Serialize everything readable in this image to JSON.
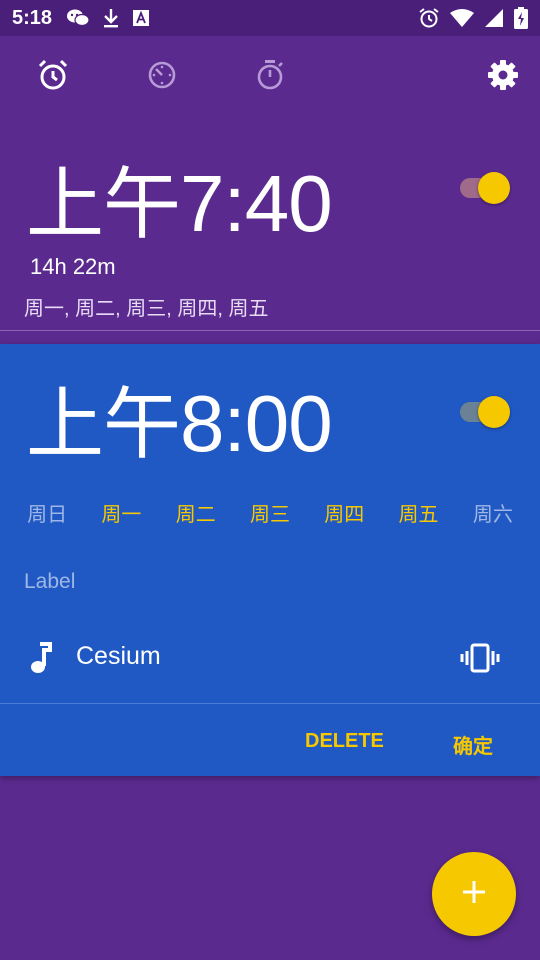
{
  "status_bar": {
    "time": "5:18",
    "left_icons": [
      "wechat-icon",
      "download-icon",
      "text-a-icon"
    ],
    "right_icons": [
      "alarm-clock-icon",
      "wifi-icon",
      "signal-icon",
      "battery-charging-icon"
    ]
  },
  "toolbar": {
    "tabs": [
      "alarm-icon",
      "clock-icon",
      "stopwatch-icon"
    ],
    "settings_icon": "gear-icon"
  },
  "alarms": [
    {
      "ampm": "上午",
      "time": "7:40",
      "remaining": "14h 22m",
      "days_summary": "周一, 周二, 周三, 周四, 周五",
      "enabled": true
    },
    {
      "ampm": "上午",
      "time": "8:00",
      "enabled": true,
      "weekdays": [
        {
          "label": "周日",
          "on": false
        },
        {
          "label": "周一",
          "on": true
        },
        {
          "label": "周二",
          "on": true
        },
        {
          "label": "周三",
          "on": true
        },
        {
          "label": "周四",
          "on": true
        },
        {
          "label": "周五",
          "on": true
        },
        {
          "label": "周六",
          "on": false
        }
      ],
      "label_placeholder": "Label",
      "ringtone": "Cesium",
      "delete_label": "DELETE",
      "confirm_label": "确定"
    }
  ],
  "colors": {
    "background": "#5b2a8f",
    "status_bar": "#4a1f7a",
    "card": "#2159c4",
    "accent": "#f5c800"
  },
  "fab_icon": "plus-icon"
}
